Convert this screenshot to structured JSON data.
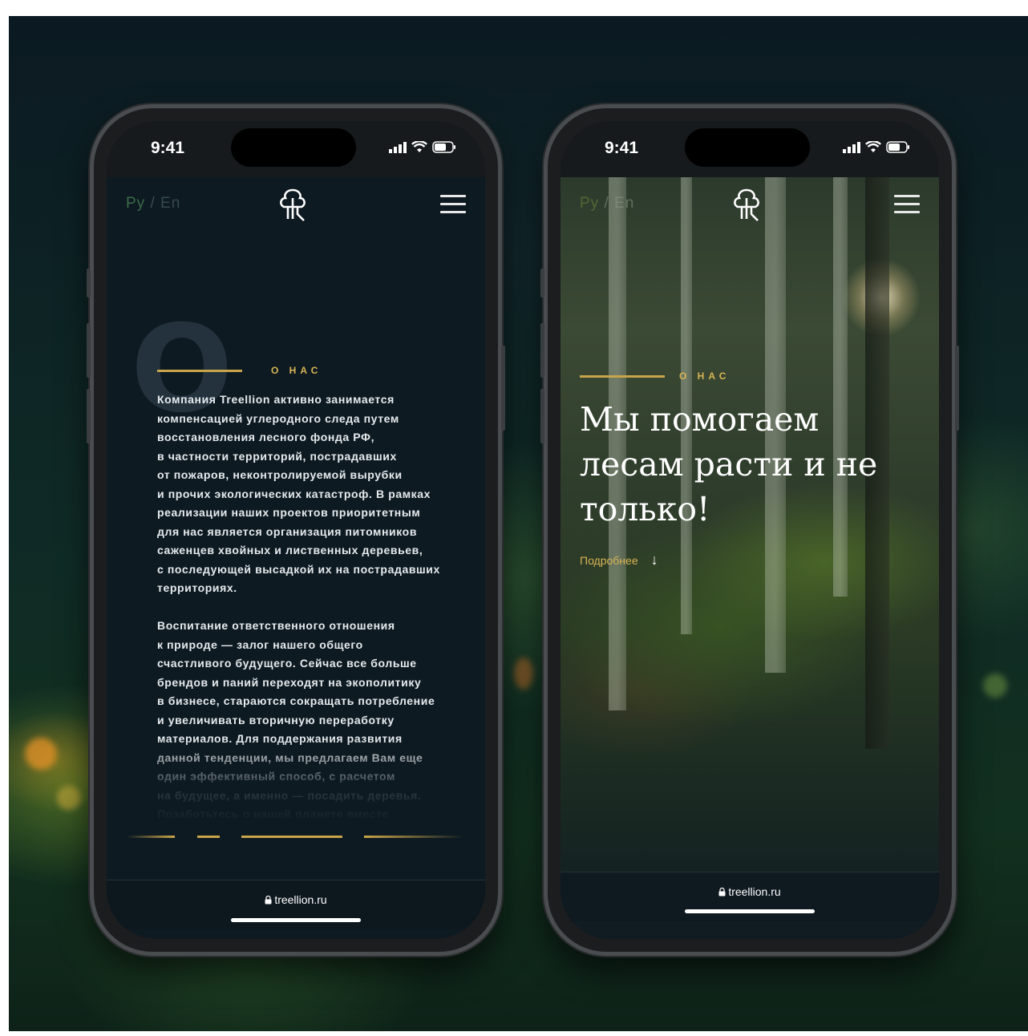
{
  "phones": [
    {
      "status": {
        "time": "9:41"
      },
      "header": {
        "lang_ru": "Ру",
        "lang_sep": " / ",
        "lang_en": "En",
        "logo": "treellion-tree-logo",
        "menu_icon": "hamburger-menu-icon"
      },
      "section_label": "О НАС",
      "decor_letter": "О",
      "paragraph_1": "Компания Treellion активно занимается\nкомпенсацией углеродного следа путем\nвосстановления лесного фонда РФ,\nв частности территорий, пострадавших\nот пожаров, неконтролируемой вырубки\nи прочих экологических катастроф. В рамках\nреализации наших проектов приоритетным\nдля нас является организация питомников\nсаженцев хвойных и лиственных деревьев,\nс последующей высадкой их на пострадавших\nтерриториях.",
      "paragraph_2": "Воспитание ответственного отношения\nк природе — залог нашего общего\nсчастливого будущего. Сейчас все больше\nбрендов и паний переходят на экополитику\nв бизнесе, стараются сокращать потребление\nи увеличивать вторичную переработку\nматериалов. Для поддержания развития\nданной тенденции, мы предлагаем Вам еще\nодин эффективный способ, с расчетом\nна будущее, а именно — посадить деревья.\nПозаботьтесь о нашей планете вместе",
      "url": "treellion.ru",
      "slider": {
        "count": 4,
        "active_index": 2
      }
    },
    {
      "status": {
        "time": "9:41"
      },
      "header": {
        "lang_ru": "Ру",
        "lang_sep": " / ",
        "lang_en": "En",
        "logo": "treellion-tree-logo",
        "menu_icon": "hamburger-menu-icon"
      },
      "section_label": "О НАС",
      "hero_title": "Мы помогаем лесам расти и не только!",
      "more_link": "Подробнее",
      "more_arrow": "↓",
      "url": "treellion.ru"
    }
  ],
  "colors": {
    "accent_gold": "#c9a54a",
    "screen_bg": "#0e1a22",
    "lang_active": "#3b6a4a"
  }
}
